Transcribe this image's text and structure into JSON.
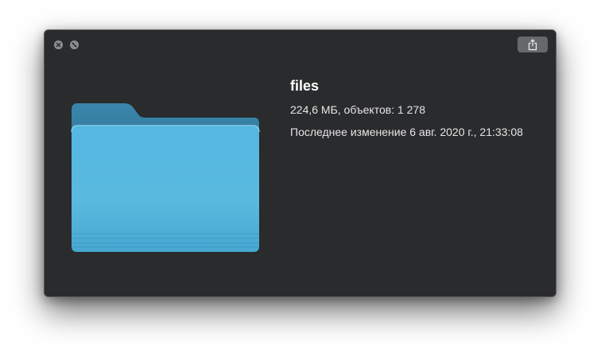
{
  "window": {
    "controls": [
      "close-icon",
      "fullscreen-icon"
    ],
    "share_icon": "share-icon"
  },
  "item": {
    "icon": "folder-icon",
    "icon_color": "#4fb4e0",
    "name": "files",
    "size_and_count": "224,6 МБ, объектов: 1 278",
    "modified": "Последнее изменение 6 авг. 2020 г., 21:33:08"
  },
  "colors": {
    "window_bg": "#2a2b2d",
    "text": "#ffffff"
  }
}
